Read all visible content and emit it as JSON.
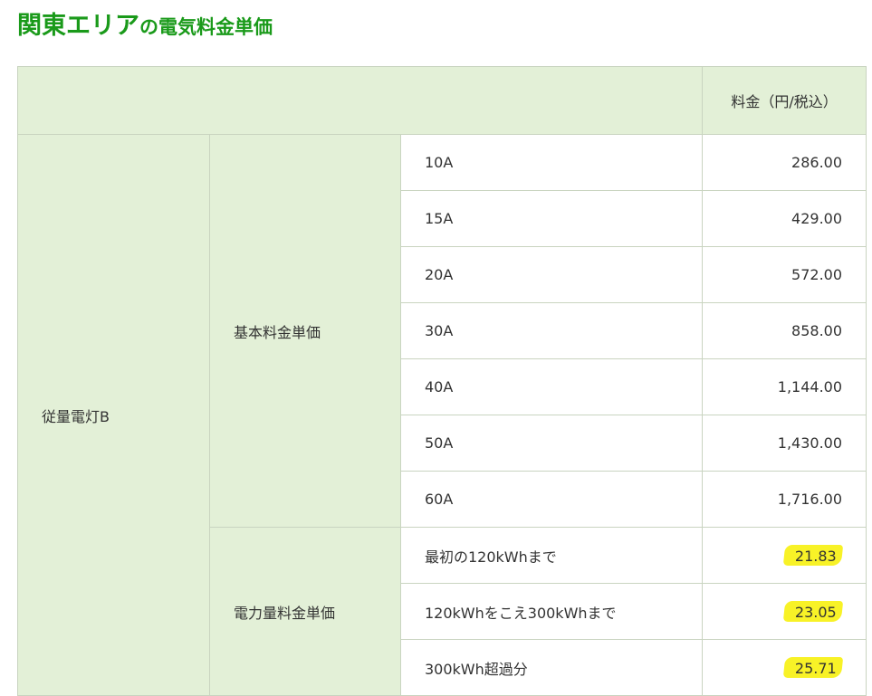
{
  "title": {
    "main": "関東エリア",
    "sub": "の電気料金単価"
  },
  "table": {
    "header_price": "料金（円/税込）",
    "plan": "従量電灯B",
    "basic": {
      "label": "基本料金単価",
      "rows": [
        {
          "label": "10A",
          "value": "286.00"
        },
        {
          "label": "15A",
          "value": "429.00"
        },
        {
          "label": "20A",
          "value": "572.00"
        },
        {
          "label": "30A",
          "value": "858.00"
        },
        {
          "label": "40A",
          "value": "1,144.00"
        },
        {
          "label": "50A",
          "value": "1,430.00"
        },
        {
          "label": "60A",
          "value": "1,716.00"
        }
      ]
    },
    "energy": {
      "label": "電力量料金単価",
      "rows": [
        {
          "label": "最初の120kWhまで",
          "value": "21.83"
        },
        {
          "label": "120kWhをこえ300kWhまで",
          "value": "23.05"
        },
        {
          "label": "300kWh超過分",
          "value": "25.71"
        }
      ]
    }
  },
  "colors": {
    "title": "#1a9a1a",
    "header_bg": "#e3f0d7",
    "highlight": "#f8f227"
  }
}
